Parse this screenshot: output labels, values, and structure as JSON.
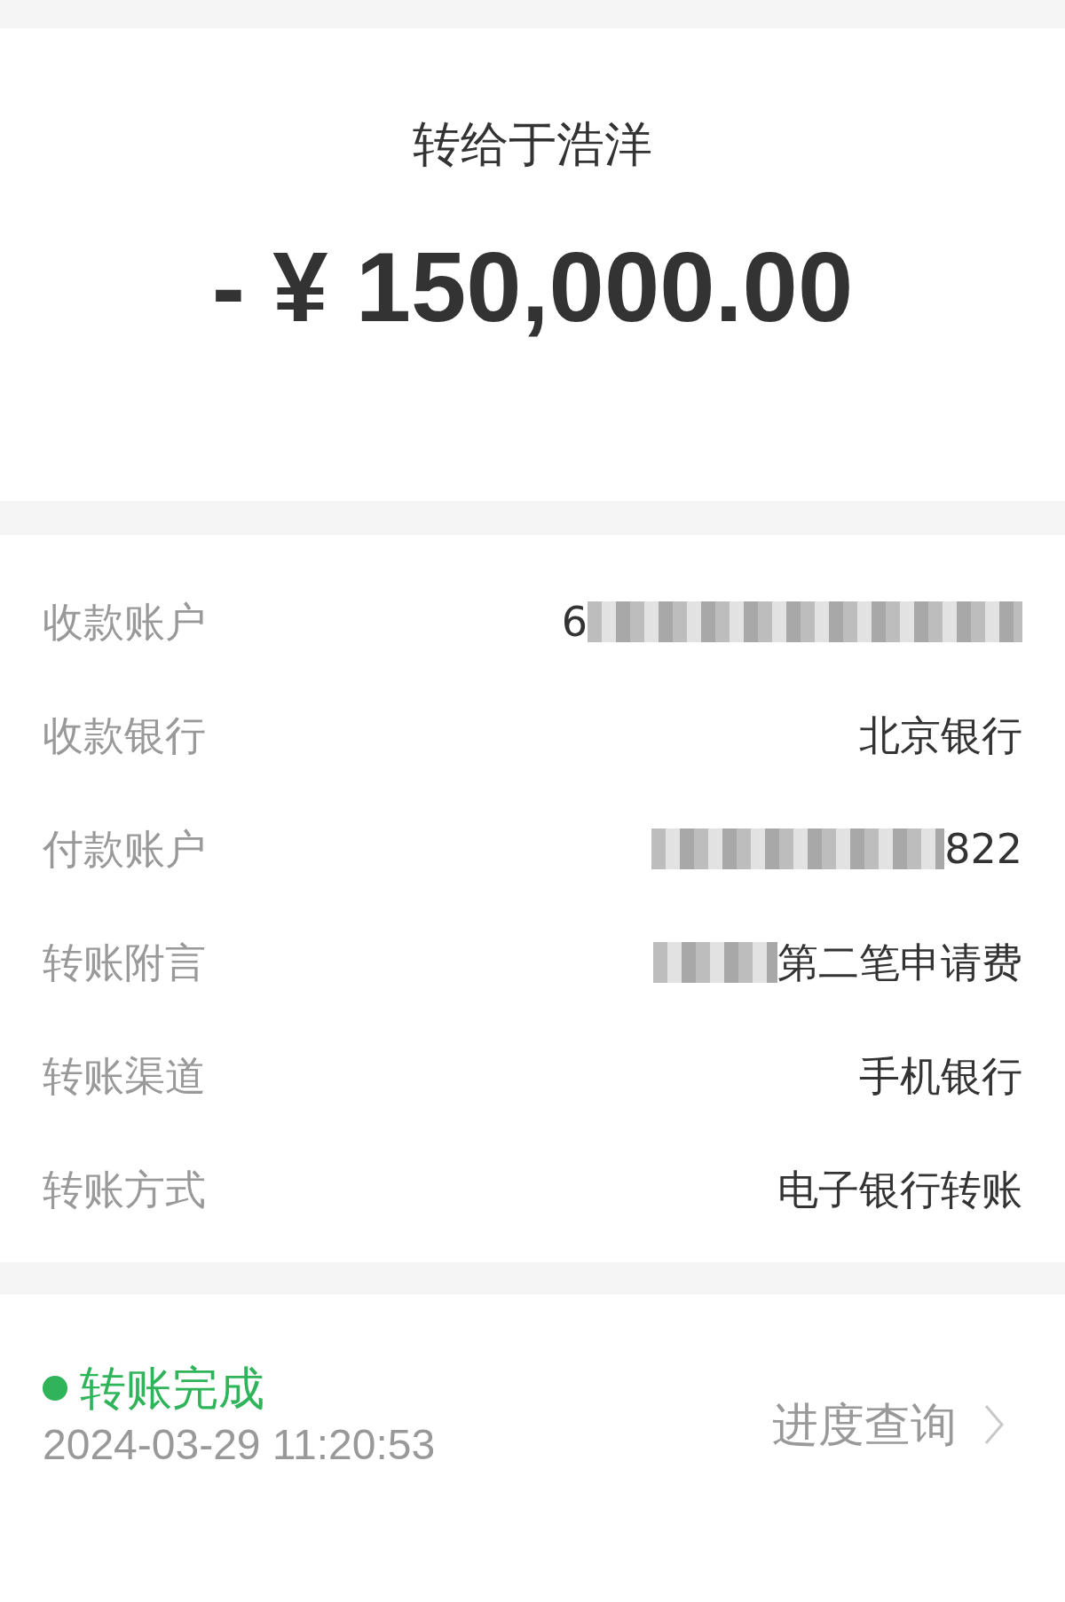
{
  "header": {
    "title": "转给于浩洋",
    "amount": "- ¥ 150,000.00"
  },
  "details": [
    {
      "label": "收款账户",
      "value": "6",
      "kind": "masktail"
    },
    {
      "label": "收款银行",
      "value": "北京银行",
      "kind": "plain"
    },
    {
      "label": "付款账户",
      "value": "822",
      "kind": "maskhead"
    },
    {
      "label": "转账附言",
      "value": "第二笔申请费",
      "kind": "maskhead"
    },
    {
      "label": "转账渠道",
      "value": "手机银行",
      "kind": "plain"
    },
    {
      "label": "转账方式",
      "value": "电子银行转账",
      "kind": "plain"
    }
  ],
  "status": {
    "text": "转账完成",
    "color": "#2fb45a",
    "time": "2024-03-29 11:20:53",
    "link": "进度查询"
  }
}
